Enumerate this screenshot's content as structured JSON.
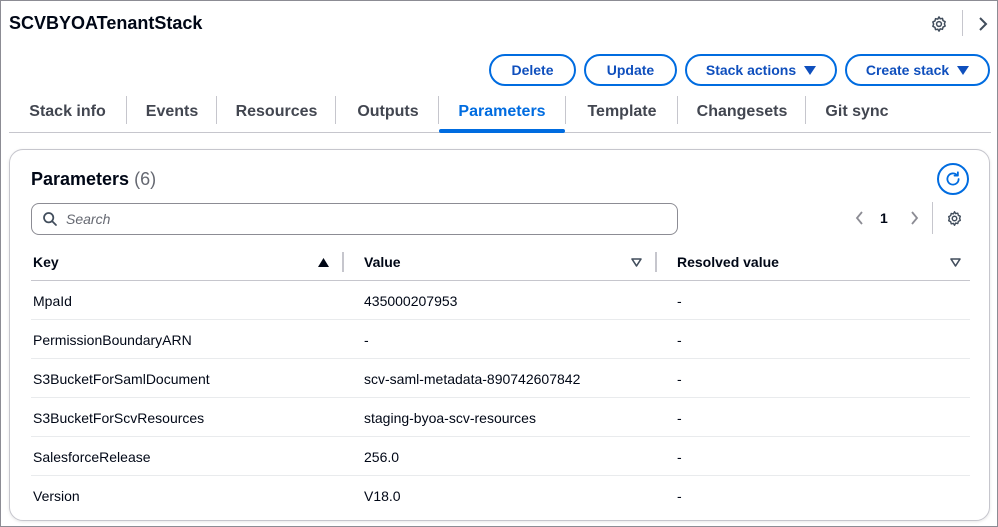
{
  "header": {
    "title": "SCVBYOATenantStack",
    "settings_icon": "gear-icon",
    "expand_icon": "chevron-right-icon"
  },
  "actions": {
    "delete": "Delete",
    "update": "Update",
    "stack_actions": "Stack actions",
    "create_stack": "Create stack"
  },
  "tabs": [
    {
      "label": "Stack info"
    },
    {
      "label": "Events"
    },
    {
      "label": "Resources"
    },
    {
      "label": "Outputs"
    },
    {
      "label": "Parameters",
      "active": true
    },
    {
      "label": "Template"
    },
    {
      "label": "Changesets"
    },
    {
      "label": "Git sync"
    }
  ],
  "panel": {
    "title": "Parameters",
    "count": "(6)",
    "refresh_icon": "refresh-icon",
    "search_placeholder": "Search",
    "page": "1"
  },
  "table": {
    "columns": [
      "Key",
      "Value",
      "Resolved value"
    ],
    "rows": [
      {
        "key": "MpaId",
        "value": "435000207953",
        "resolved": "-"
      },
      {
        "key": "PermissionBoundaryARN",
        "value": "-",
        "resolved": "-"
      },
      {
        "key": "S3BucketForSamlDocument",
        "value": "scv-saml-metadata-890742607842",
        "resolved": "-"
      },
      {
        "key": "S3BucketForScvResources",
        "value": "staging-byoa-scv-resources",
        "resolved": "-"
      },
      {
        "key": "SalesforceRelease",
        "value": "256.0",
        "resolved": "-"
      },
      {
        "key": "Version",
        "value": "V18.0",
        "resolved": "-"
      }
    ]
  },
  "colors": {
    "accent": "#006ce0",
    "text": "#000716",
    "border": "#c6c6cd"
  }
}
